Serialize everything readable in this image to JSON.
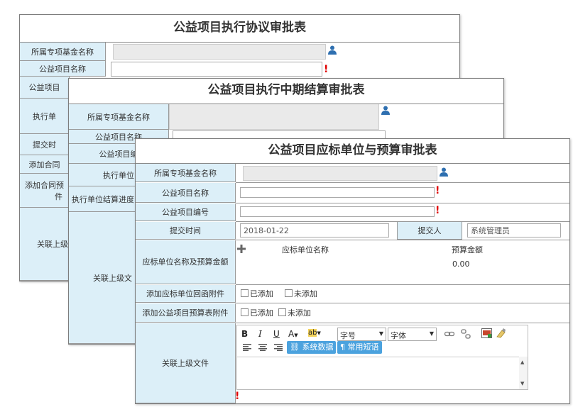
{
  "form1": {
    "title": "公益项目执行协议审批表",
    "labels": [
      "所属专项基金名称",
      "公益项目名称",
      "公益项目",
      "执行单",
      "提交时",
      "添加合同",
      "添加合同预",
      "关联上级"
    ],
    "extra_label": "件"
  },
  "form2": {
    "title": "公益项目执行中期结算审批表",
    "labels": [
      "所属专项基金名称",
      "公益项目名称",
      "公益项目编",
      "执行单位",
      "执行单位结算进度",
      "关联上级文"
    ]
  },
  "form3": {
    "title": "公益项目应标单位与预算审批表",
    "fund_label": "所属专项基金名称",
    "project_name_label": "公益项目名称",
    "project_no_label": "公益项目编号",
    "submit_time_label": "提交时间",
    "submit_time_value": "2018-01-22",
    "submitter_label": "提交人",
    "submitter_value": "系统管理员",
    "budget_label": "应标单位名称及预算金额",
    "unit_col": "应标单位名称",
    "budget_col": "预算金额",
    "budget_value": "0.00",
    "reply_attach_label": "添加应标单位回函附件",
    "budget_attach_label": "添加公益项目预算表附件",
    "added": "已添加",
    "not_added": "未添加",
    "related_docs_label": "关联上级文件",
    "editor": {
      "bold": "B",
      "italic": "I",
      "underline": "U",
      "font_color": "A",
      "font_size": "字号",
      "font_family": "字体",
      "sys_data": "系统数据",
      "common_phrases": "常用短语"
    },
    "required_mark": "!",
    "colors": {
      "label_bg": "#dceff8",
      "accent": "#4ba2de",
      "required": "#e00000",
      "icon": "#2e6fb0"
    }
  }
}
